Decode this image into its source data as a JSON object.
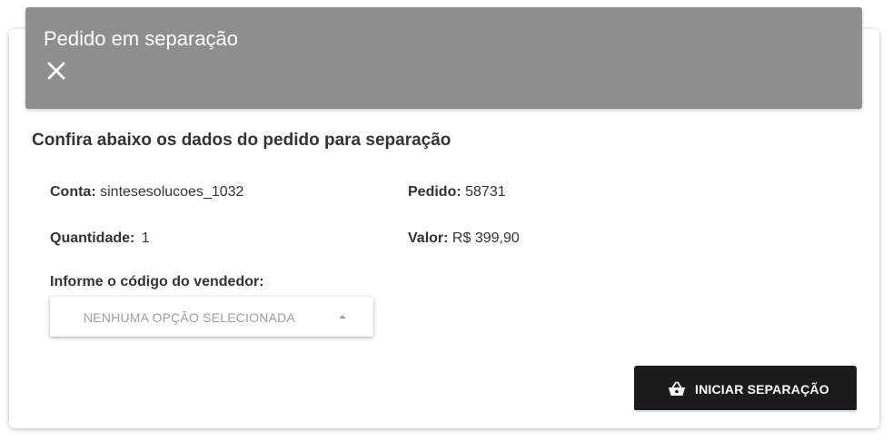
{
  "dialog": {
    "title": "Pedido em separação",
    "subtitle": "Confira abaixo os dados do pedido para separação"
  },
  "details": {
    "conta_label": "Conta:",
    "conta_value": "sintesesolucoes_1032",
    "pedido_label": "Pedido:",
    "pedido_value": "58731",
    "quantidade_label": "Quantidade:",
    "quantidade_value": "1",
    "valor_label": "Valor:",
    "valor_value": "R$ 399,90"
  },
  "seller_select": {
    "label": "Informe o código do vendedor:",
    "selected": "NENHUMA OPÇÃO SELECIONADA"
  },
  "actions": {
    "start_label": "INICIAR SEPARAÇÃO"
  },
  "icons": {
    "close": "close-icon",
    "caret": "caret-up-icon",
    "basket": "basket-icon"
  },
  "colors": {
    "header": "#8e8e8e",
    "button": "#1c1c1c"
  }
}
